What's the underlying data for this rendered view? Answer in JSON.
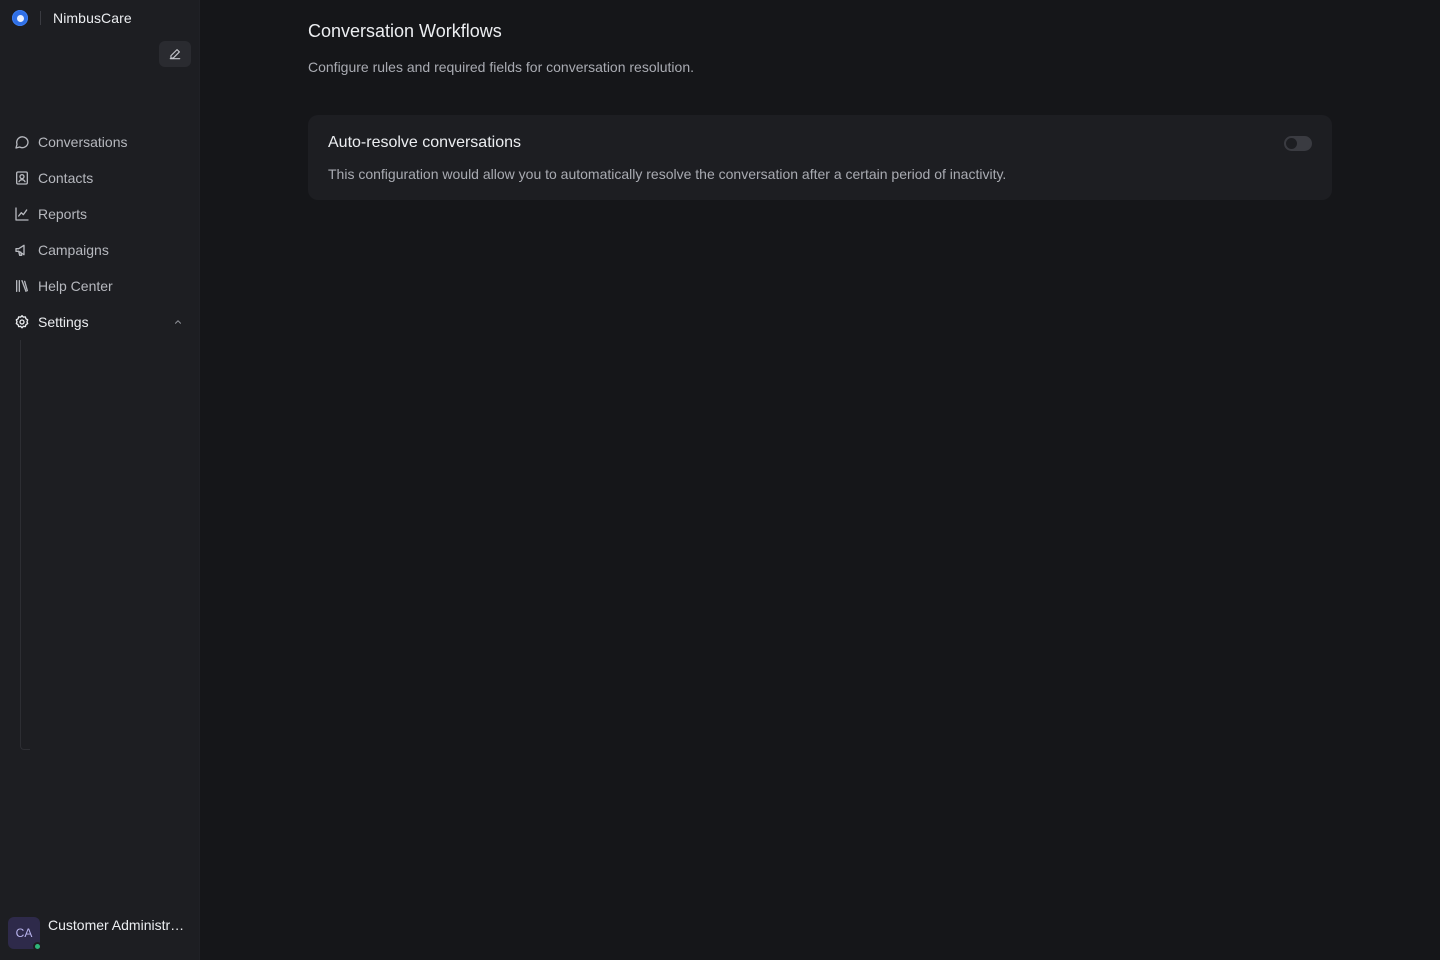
{
  "brand": {
    "name": "NimbusCare",
    "logo_color": "#2f6fe6"
  },
  "sidebar": {
    "compose_icon": "pencil-square-icon",
    "items": [
      {
        "label": "Conversations",
        "icon": "chat-bubble-icon"
      },
      {
        "label": "Contacts",
        "icon": "contact-card-icon"
      },
      {
        "label": "Reports",
        "icon": "line-chart-icon"
      },
      {
        "label": "Campaigns",
        "icon": "megaphone-icon"
      },
      {
        "label": "Help Center",
        "icon": "library-icon"
      },
      {
        "label": "Settings",
        "icon": "gear-icon",
        "expanded": true
      }
    ]
  },
  "profile": {
    "initials": "CA",
    "name": "Customer Administrator",
    "status": "online",
    "status_color": "#2fb57b"
  },
  "main": {
    "title": "Conversation Workflows",
    "subtitle": "Configure rules and required fields for conversation resolution.",
    "card": {
      "title": "Auto-resolve conversations",
      "description": "This configuration would allow you to automatically resolve the conversation after a certain period of inactivity.",
      "toggle_enabled": false
    }
  }
}
